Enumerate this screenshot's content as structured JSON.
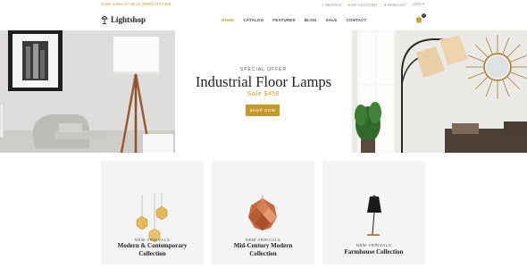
{
  "topbar": {
    "note": "Order online or call us (0800) 123 4456",
    "links": [
      "SEARCH",
      "MY ACCOUNT",
      "WISHLIST",
      "USD"
    ]
  },
  "header": {
    "logo_text": "Lightshop",
    "nav": [
      "HOME",
      "CATALOG",
      "FEATURES",
      "BLOG",
      "SALE",
      "CONTACT"
    ],
    "cart_count": "0"
  },
  "hero": {
    "eyebrow": "SPECIAL OFFER",
    "title": "Industrial Floor Lamps",
    "price": "Sale $459",
    "button": "SHOP NOW"
  },
  "collections": [
    {
      "eyebrow": "NEW ARRIVALS",
      "title_line1": "Modern & Contemporary",
      "title_line2": "Collection"
    },
    {
      "eyebrow": "NEW ARRIVALS",
      "title_line1": "Mid-Century Modern",
      "title_line2": "Collection"
    },
    {
      "eyebrow": "NEW ARRIVALS",
      "title_line1": "Farmhouse Collection",
      "title_line2": ""
    }
  ],
  "colors": {
    "accent": "#c9a227",
    "button": "#c79b2b"
  }
}
